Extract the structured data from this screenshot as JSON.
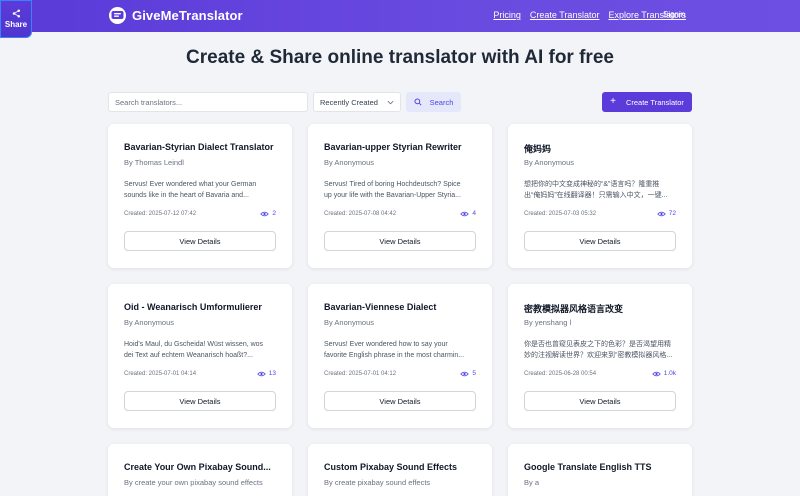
{
  "share": {
    "label": "Share",
    "icon": "share-icon"
  },
  "brand": {
    "name": "GiveMeTranslator",
    "icon": "logo-icon",
    "color": "#5b3bd9"
  },
  "nav": {
    "items": [
      {
        "label": "Pricing"
      },
      {
        "label": "Create Translator"
      },
      {
        "label": "Explore Translators"
      }
    ],
    "signin": "Signin"
  },
  "title": "Create & Share online translator with AI for free",
  "toolbar": {
    "search_placeholder": "Search translators...",
    "sort_value": "Recently Created",
    "search_label": "Search",
    "create_label": "Create Translator"
  },
  "cards": [
    {
      "title": "Bavarian-Styrian Dialect Translator",
      "author": "By Thomas Leindl",
      "desc1": "Servus! Ever wondered what your German",
      "desc2": "sounds like in the heart of Bavaria and...",
      "created": "Created: 2025-07-12 07:42",
      "views": "2",
      "button": "View Details"
    },
    {
      "title": "Bavarian-upper Styrian Rewriter",
      "author": "By Anonymous",
      "desc1": "Servus! Tired of boring Hochdeutsch? Spice",
      "desc2": "up your life with the Bavarian-Upper Styria...",
      "created": "Created: 2025-07-08 04:42",
      "views": "4",
      "button": "View Details"
    },
    {
      "title": "俺妈妈",
      "author": "By Anonymous",
      "desc1": "想把你的中文变成神秘的“&”语言吗？隆重推",
      "desc2": "出“俺妈妈”在线翻译器！只需输入中文，一键...",
      "created": "Created: 2025-07-03 05:32",
      "views": "72",
      "button": "View Details"
    },
    {
      "title": "Oid - Weanarisch Umformulierer",
      "author": "By Anonymous",
      "desc1": "Hoid's Maul, du Gscheida! Wüst wissen, wos",
      "desc2": "dei Text auf echtem Weanarisch hoaßt?...",
      "created": "Created: 2025-07-01 04:14",
      "views": "13",
      "button": "View Details"
    },
    {
      "title": "Bavarian-Viennese Dialect",
      "author": "By Anonymous",
      "desc1": "Servus! Ever wondered how to say your",
      "desc2": "favorite English phrase in the most charmin...",
      "created": "Created: 2025-07-01 04:12",
      "views": "5",
      "button": "View Details"
    },
    {
      "title": "密教模拟器风格语言改变",
      "author": "By yenshang l",
      "desc1": "你是否也曾窥见表皮之下的色彩？是否渴望用精",
      "desc2": "妙的注视解读世界？欢迎来到“密教模拟器风格...",
      "created": "Created: 2025-06-28 00:54",
      "views": "1.0k",
      "button": "View Details"
    },
    {
      "title": "Create Your Own Pixabay Sound...",
      "author": "By create your own pixabay sound effects"
    },
    {
      "title": "Custom Pixabay Sound Effects",
      "author": "By create pixabay sound effects"
    },
    {
      "title": "Google Translate English TTS",
      "author": "By a"
    }
  ],
  "colors": {
    "accent": "#5b3bd9",
    "views": "#4f46e5",
    "background": "#f3f4f8"
  }
}
